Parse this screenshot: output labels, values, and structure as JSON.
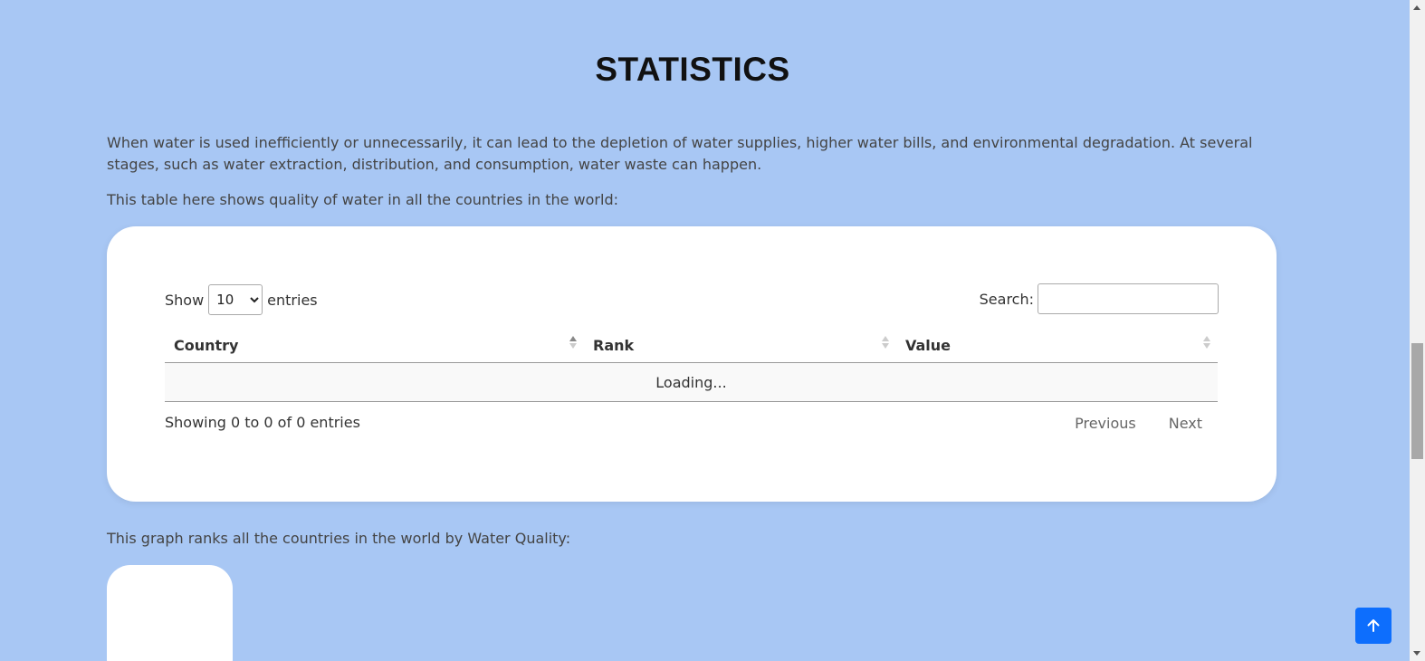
{
  "section": {
    "title": "STATISTICS",
    "intro": "When water is used inefficiently or unnecessarily, it can lead to the depletion of water supplies, higher water bills, and environmental degradation. At several stages, such as water extraction, distribution, and consumption, water waste can happen.",
    "table_caption": "This table here shows quality of water in all the countries in the world:",
    "graph_caption": "This graph ranks all the countries in the world by Water Quality:"
  },
  "datatable": {
    "show_label": "Show",
    "entries_label": "entries",
    "page_length": "10",
    "page_length_options": [
      "10"
    ],
    "search_label": "Search:",
    "search_value": "",
    "columns": [
      "Country",
      "Rank",
      "Value"
    ],
    "loading_text": "Loading...",
    "info_text": "Showing 0 to 0 of 0 entries",
    "previous_label": "Previous",
    "next_label": "Next"
  },
  "icons": {
    "back_to_top": "arrow-up-icon"
  },
  "colors": {
    "page_background": "#a8c7f4",
    "card_background": "#ffffff",
    "accent": "#0d6efd"
  }
}
